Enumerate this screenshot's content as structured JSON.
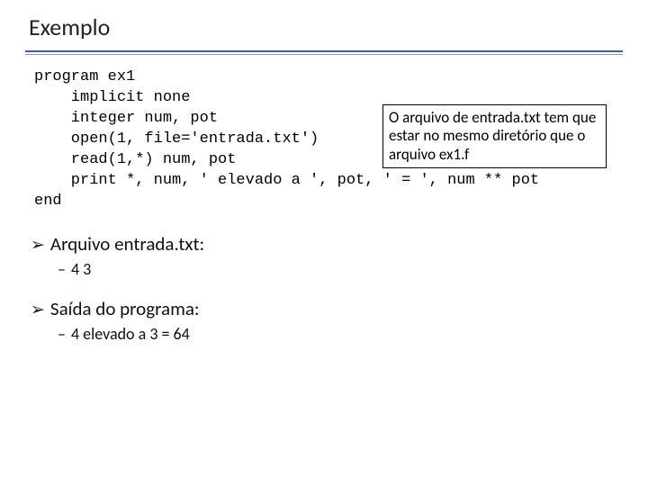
{
  "title": "Exemplo",
  "code": "program ex1\n    implicit none\n    integer num, pot\n    open(1, file='entrada.txt')\n    read(1,*) num, pot\n    print *, num, ' elevado a ', pot, ' = ', num ** pot\nend",
  "callout": "O arquivo de entrada.txt tem que estar no mesmo diretório que o arquivo ex1.f",
  "section1": {
    "heading": "Arquivo entrada.txt:",
    "item": "4        3"
  },
  "section2": {
    "heading": "Saída do programa:",
    "item": "4 elevado a 3 = 64"
  }
}
